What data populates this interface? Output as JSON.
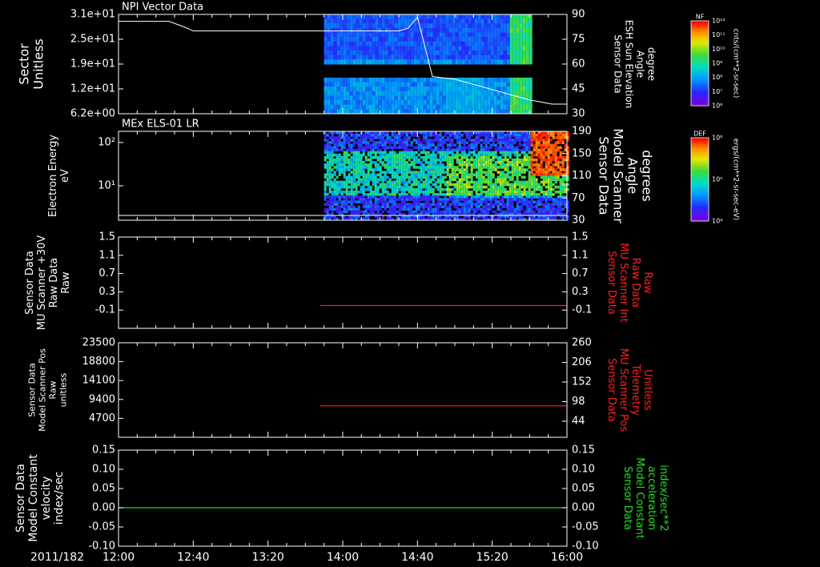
{
  "colors": {
    "background": "#000000",
    "axis": "#ffffff",
    "red_trace": "#ff2020",
    "green_trace": "#20e020"
  },
  "time_axis": {
    "date_label": "2011/182",
    "ticks": [
      "12:00",
      "12:40",
      "13:20",
      "14:00",
      "14:40",
      "15:20",
      "16:00"
    ]
  },
  "chart_data": [
    {
      "type": "heatmap",
      "title": "NPI Vector Data",
      "ylabel": [
        "Sector",
        "Unitless"
      ],
      "yticks": [
        "3.1e+01",
        "2.5e+01",
        "1.9e+01",
        "1.2e+01",
        "6.2e+00"
      ],
      "right_ylabel": [
        "Sensor Data",
        "ESH Sun Elevation",
        "Angle",
        "degree"
      ],
      "right_yticks": [
        "90",
        "75",
        "60",
        "45",
        "30"
      ],
      "right_ylim": [
        18,
        90
      ],
      "data_start": "13:50",
      "data_end": "15:40",
      "overlay_line": {
        "x": [
          "12:00",
          "12:27",
          "12:35",
          "12:40",
          "14:18",
          "14:25",
          "14:30",
          "14:35",
          "14:40",
          "14:48",
          "15:00",
          "15:40",
          "15:52",
          "16:00"
        ],
        "y": [
          85,
          85,
          81,
          78,
          78,
          78,
          78,
          80,
          88,
          45,
          43,
          28,
          25,
          25
        ]
      },
      "colorbar": {
        "label": "NF",
        "ticks": [
          "10¹²",
          "10¹¹",
          "10¹⁰",
          "10⁹",
          "10⁸",
          "10⁷",
          "10⁶"
        ],
        "units": "cnts/(cm**2-sr-sec)"
      }
    },
    {
      "type": "heatmap",
      "title": "MEx ELS-01 LR",
      "ylabel": [
        "Electron Energy",
        "eV"
      ],
      "yticks": [
        "10²",
        "10¹"
      ],
      "right_ylabel": [
        "Sensor Data",
        "Model Scanner",
        "Angle",
        "degrees"
      ],
      "right_yticks": [
        "190",
        "150",
        "110",
        "70",
        "30"
      ],
      "data_start": "13:50",
      "data_end": "16:00",
      "colorbar": {
        "label": "DEF",
        "ticks": [
          "10⁶",
          "10⁵",
          "10⁴"
        ],
        "units": "ergs/(cm**2-sr-sec-eV)"
      }
    },
    {
      "type": "line",
      "ylabel": [
        "Sensor Data",
        "MU Scanner +30V",
        "Raw Data",
        "Raw"
      ],
      "yticks": [
        "1.5",
        "1.1",
        "0.7",
        "0.3",
        "-0.1"
      ],
      "ylim": [
        -0.5,
        1.5
      ],
      "right_ylabel": [
        "Sensor Data",
        "MU Scanner Int",
        "Raw Data",
        "Raw"
      ],
      "right_yticks": [
        "1.5",
        "1.1",
        "0.7",
        "0.3",
        "-0.1"
      ],
      "series": [
        {
          "color": "#ff2020",
          "x": [
            "13:48",
            "16:00"
          ],
          "y": [
            0.0,
            0.0
          ]
        }
      ]
    },
    {
      "type": "line",
      "ylabel": [
        "Sensor Data",
        "Model Scanner Pos",
        "Raw",
        "unitless"
      ],
      "yticks": [
        "23500",
        "18800",
        "14100",
        "9400",
        "4700"
      ],
      "ylim": [
        0,
        23500
      ],
      "right_ylabel": [
        "Sensor Data",
        "MU Scanner Pos",
        "Telemetry",
        "Unitless"
      ],
      "right_yticks": [
        "260",
        "206",
        "152",
        "98",
        "44"
      ],
      "series": [
        {
          "color": "#ff2020",
          "x": [
            "13:48",
            "16:00"
          ],
          "y": [
            7800,
            7800
          ]
        }
      ]
    },
    {
      "type": "line",
      "ylabel": [
        "Sensor Data",
        "Model Constant",
        "velocity",
        "index/sec"
      ],
      "yticks": [
        "0.15",
        "0.10",
        "0.05",
        "0.00",
        "-0.05",
        "-0.10"
      ],
      "ylim": [
        -0.1,
        0.15
      ],
      "right_ylabel": [
        "Sensor Data",
        "Model Constant",
        "acceleration",
        "index/sec**2"
      ],
      "right_yticks": [
        "0.15",
        "0.10",
        "0.05",
        "0.00",
        "-0.05",
        "-0.10"
      ],
      "series": [
        {
          "color": "#20e020",
          "x": [
            "12:00",
            "16:00"
          ],
          "y": [
            0.0,
            0.0
          ]
        }
      ]
    }
  ]
}
